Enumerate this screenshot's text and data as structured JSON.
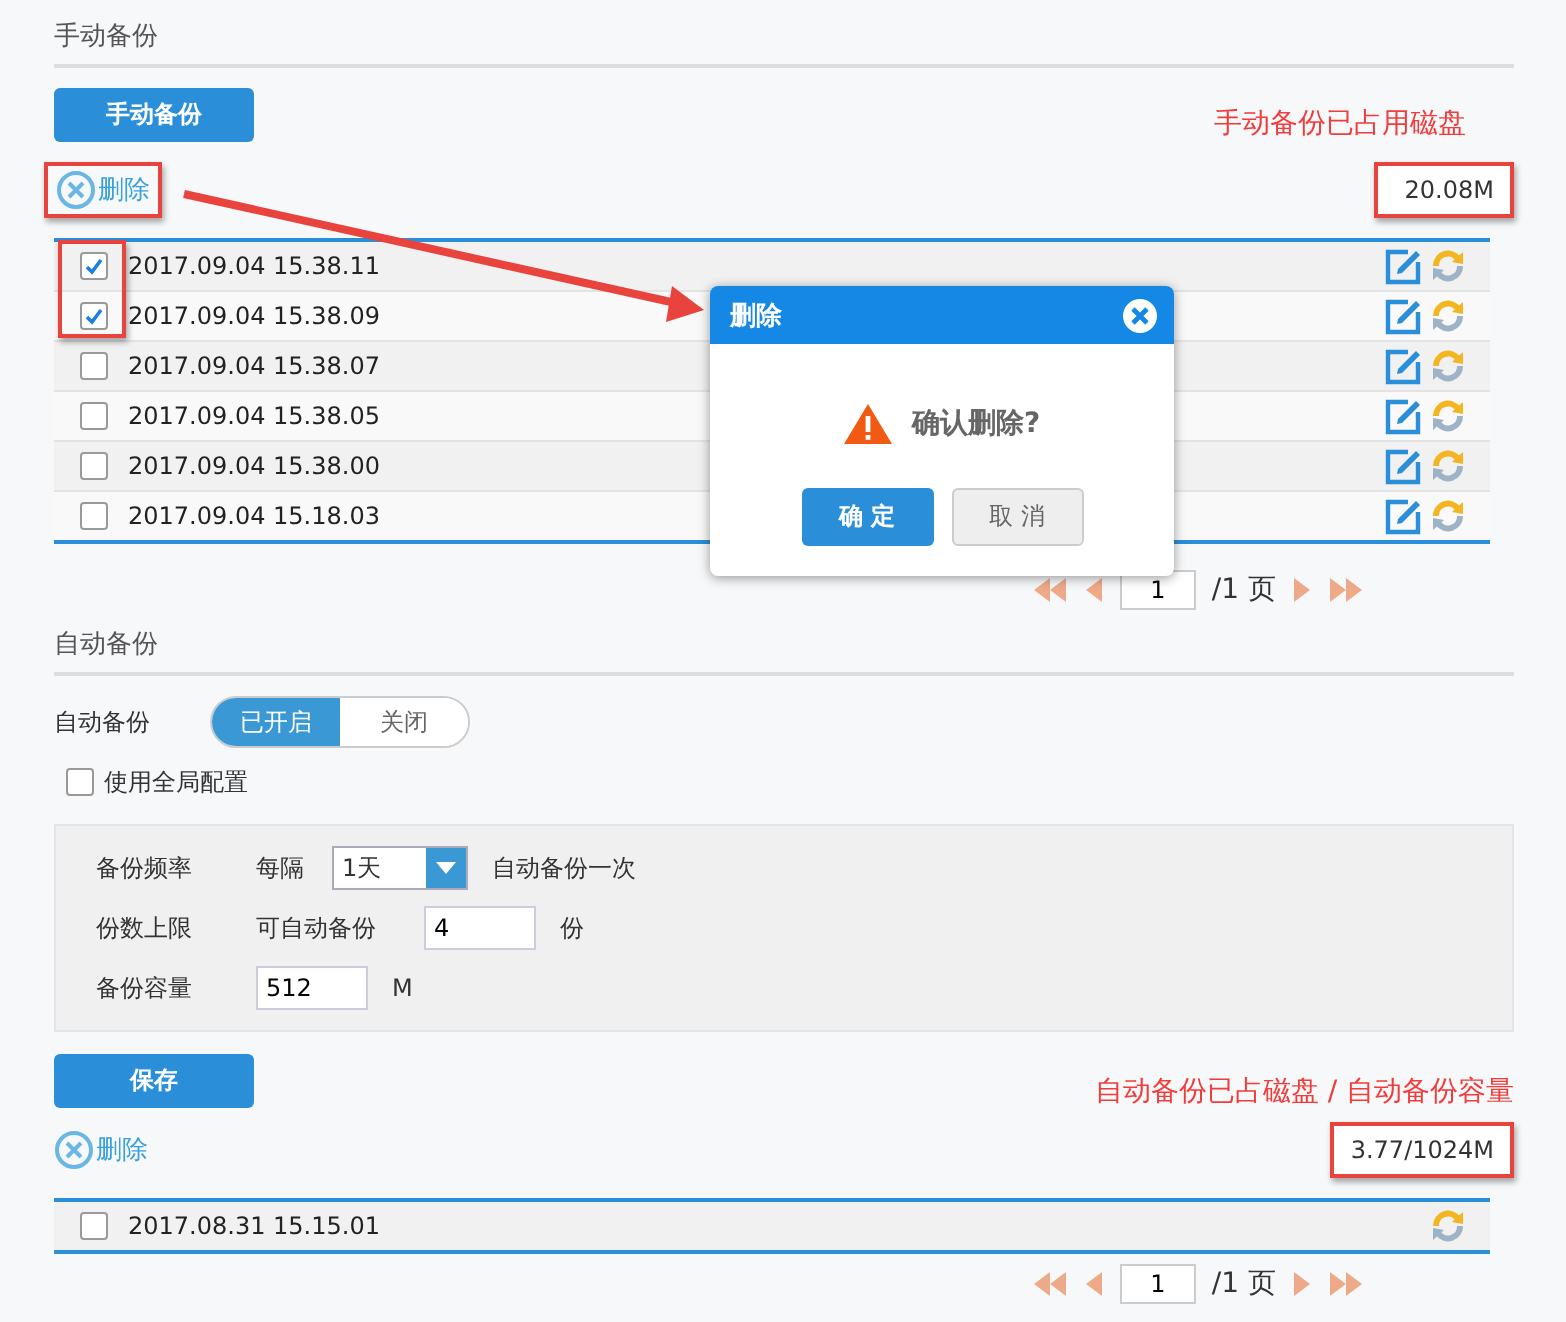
{
  "manual_backup": {
    "title": "手动备份",
    "backup_button": "手动备份",
    "annotation": "手动备份已占用磁盘",
    "delete_link": "删除",
    "usage": "20.08M",
    "rows": [
      {
        "time": "2017.09.04 15.38.11",
        "checked": true,
        "editable": true
      },
      {
        "time": "2017.09.04 15.38.09",
        "checked": true,
        "editable": true
      },
      {
        "time": "2017.09.04 15.38.07",
        "checked": false,
        "editable": true
      },
      {
        "time": "2017.09.04 15.38.05",
        "checked": false,
        "editable": true
      },
      {
        "time": "2017.09.04 15.38.00",
        "checked": false,
        "editable": true
      },
      {
        "time": "2017.09.04 15.18.03",
        "checked": false,
        "editable": true
      }
    ],
    "pagination": {
      "page": "1",
      "total": "/1 页"
    }
  },
  "dialog": {
    "title": "删除",
    "message": "确认删除?",
    "confirm": "确 定",
    "cancel": "取 消"
  },
  "auto_backup": {
    "title": "自动备份",
    "toggle_label": "自动备份",
    "toggle_options": [
      {
        "label": "已开启",
        "selected": true
      },
      {
        "label": "关闭",
        "selected": false
      }
    ],
    "use_global": {
      "label": "使用全局配置",
      "checked": false
    },
    "frequency": {
      "label": "备份频率",
      "prefix": "每隔",
      "value": "1天",
      "suffix": "自动备份一次"
    },
    "limit": {
      "label": "份数上限",
      "prefix": "可自动备份",
      "value": "4",
      "suffix": "份"
    },
    "capacity": {
      "label": "备份容量",
      "value": "512",
      "unit": "M"
    },
    "save_button": "保存",
    "annotation": "自动备份已占磁盘 / 自动备份容量",
    "delete_link": "删除",
    "usage": "3.77/1024M",
    "rows": [
      {
        "time": "2017.08.31 15.15.01",
        "checked": false,
        "editable": false
      }
    ],
    "pagination": {
      "page": "1",
      "total": "/1 页"
    }
  }
}
